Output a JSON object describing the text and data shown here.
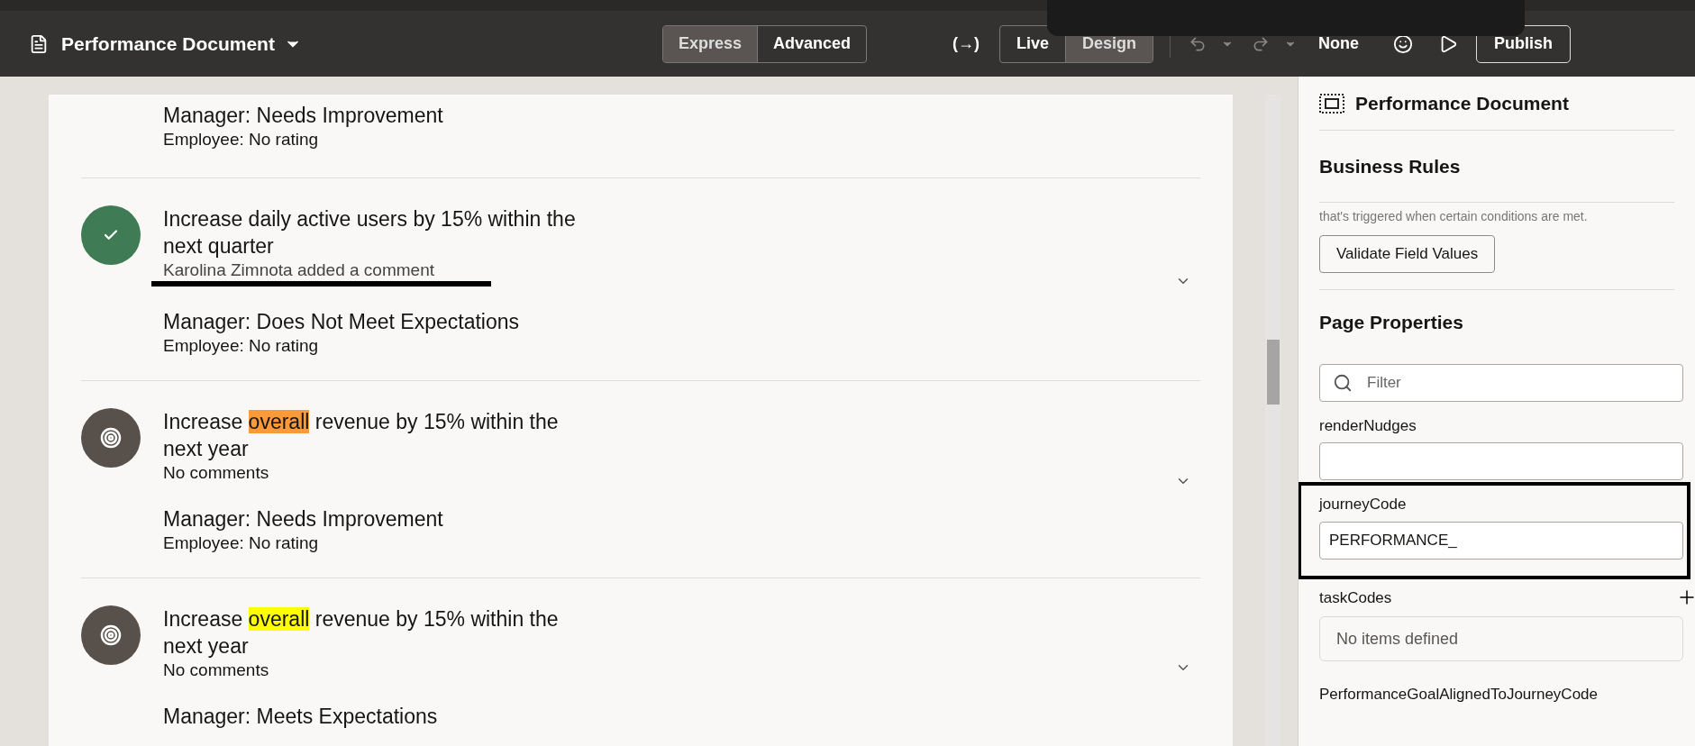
{
  "header": {
    "title": "Performance Document",
    "mode_tabs": [
      {
        "label": "Express",
        "selected": true
      },
      {
        "label": "Advanced",
        "selected": false
      }
    ],
    "view_tabs": [
      {
        "label": "Live",
        "selected": false
      },
      {
        "label": "Design",
        "selected": true
      }
    ],
    "toggle_label": "(→)",
    "theme_label": "None",
    "publish": "Publish"
  },
  "goals": [
    {
      "manager": "Manager: Needs Improvement",
      "employee": "Employee: No rating"
    },
    {
      "kind": "achieved",
      "title": [
        {
          "text": "Increase daily active users by 15% within the next quarter"
        }
      ],
      "comment": "Karolina Zimnota added a comment",
      "redacted": true,
      "manager": "Manager: Does Not Meet Expectations",
      "employee": "Employee: No rating"
    },
    {
      "kind": "goal",
      "title": [
        {
          "text": "Increase "
        },
        {
          "text": "overall",
          "color": "#fb9a38"
        },
        {
          "text": " revenue by 15% within the next year"
        }
      ],
      "comment": "No comments",
      "manager": "Manager: Needs Improvement",
      "employee": "Employee: No rating"
    },
    {
      "kind": "goal",
      "title": [
        {
          "text": "Increase "
        },
        {
          "text": "overall",
          "color": "#ffff00"
        },
        {
          "text": " revenue by 15% within the next year"
        }
      ],
      "comment": "No comments",
      "manager": "Manager: Meets Expectations"
    }
  ],
  "panel": {
    "title": "Performance Document",
    "business_rules": {
      "heading": "Business Rules",
      "description": "that's triggered when certain conditions are met.",
      "button": "Validate Field Values"
    },
    "page_properties": {
      "heading": "Page Properties",
      "filter_placeholder": "Filter",
      "fields": [
        {
          "kind": "input",
          "label": "renderNudges"
        },
        {
          "kind": "input",
          "label": "journeyCode",
          "value": "PERFORMANCE_",
          "marked": true
        },
        {
          "kind": "list",
          "label": "taskCodes",
          "value": "No items defined"
        },
        {
          "kind": "label",
          "label": "PerformanceGoalAlignedToJourneyCode"
        }
      ]
    }
  }
}
